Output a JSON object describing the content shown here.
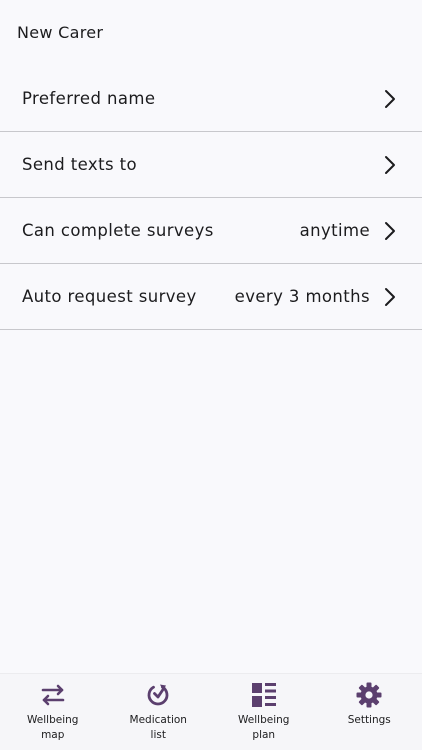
{
  "header": {
    "title": "New Carer"
  },
  "settings": {
    "rows": [
      {
        "label": "Preferred name",
        "value": ""
      },
      {
        "label": "Send texts to",
        "value": ""
      },
      {
        "label": "Can complete surveys",
        "value": "anytime"
      },
      {
        "label": "Auto request survey",
        "value": "every 3 months"
      }
    ]
  },
  "tabbar": {
    "accent_color": "#5b3f6e",
    "tabs": [
      {
        "label": "Wellbeing\nmap",
        "icon": "swap-arrows-icon"
      },
      {
        "label": "Medication\nlist",
        "icon": "refresh-check-icon"
      },
      {
        "label": "Wellbeing\nplan",
        "icon": "list-grid-icon"
      },
      {
        "label": "Settings",
        "icon": "gear-icon"
      }
    ]
  }
}
